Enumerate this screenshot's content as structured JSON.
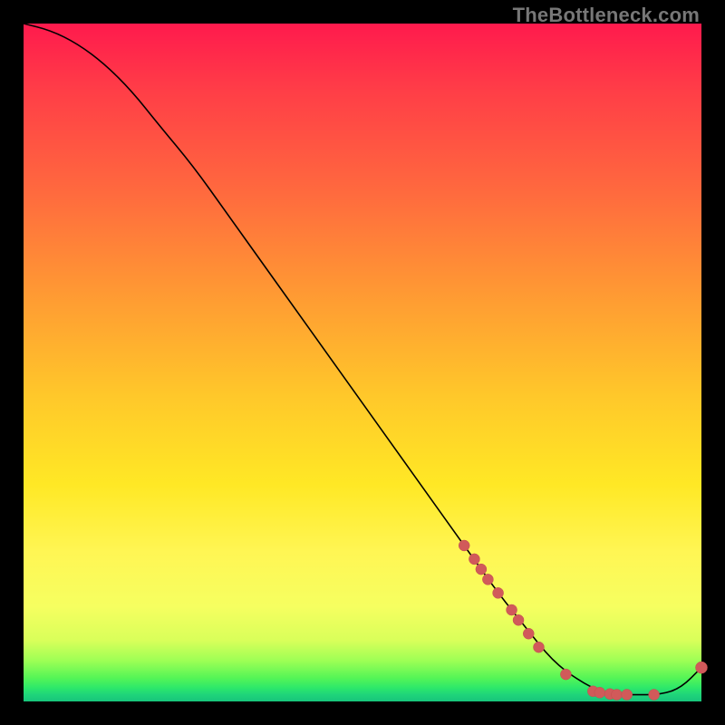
{
  "watermark": "TheBottleneck.com",
  "colors": {
    "background": "#000000",
    "curve": "#000000",
    "marker_fill": "#d15a5a",
    "marker_stroke": "#c24f4f"
  },
  "chart_data": {
    "type": "line",
    "title": "",
    "xlabel": "",
    "ylabel": "",
    "xlim": [
      0,
      100
    ],
    "ylim": [
      0,
      100
    ],
    "grid": false,
    "legend": false,
    "background_gradient": {
      "top": "#ff1a4d",
      "bottom": "#17c57b",
      "description": "vertical red-to-green heat gradient; green only near bottom"
    },
    "series": [
      {
        "name": "bottleneck-curve",
        "x": [
          0,
          4,
          8,
          12,
          16,
          20,
          25,
          30,
          35,
          40,
          45,
          50,
          55,
          60,
          65,
          70,
          74,
          78,
          82,
          86,
          90,
          94,
          97,
          100
        ],
        "y": [
          100,
          99,
          97,
          94,
          90,
          85,
          79,
          72,
          65,
          58,
          51,
          44,
          37,
          30,
          23,
          16,
          11,
          6,
          3,
          1,
          1,
          1,
          2,
          5
        ]
      }
    ],
    "markers": [
      {
        "name": "cluster-a",
        "points": [
          {
            "x": 65,
            "y": 23
          },
          {
            "x": 66.5,
            "y": 21
          },
          {
            "x": 67.5,
            "y": 19.5
          },
          {
            "x": 68.5,
            "y": 18
          },
          {
            "x": 70,
            "y": 16
          }
        ]
      },
      {
        "name": "cluster-b",
        "points": [
          {
            "x": 72,
            "y": 13.5
          },
          {
            "x": 73,
            "y": 12
          },
          {
            "x": 74.5,
            "y": 10
          },
          {
            "x": 76,
            "y": 8
          }
        ]
      },
      {
        "name": "cluster-c",
        "points": [
          {
            "x": 80,
            "y": 4
          }
        ]
      },
      {
        "name": "cluster-d",
        "points": [
          {
            "x": 84,
            "y": 1.5
          },
          {
            "x": 85,
            "y": 1.3
          },
          {
            "x": 86.5,
            "y": 1.1
          },
          {
            "x": 87.5,
            "y": 1
          },
          {
            "x": 89,
            "y": 1
          }
        ]
      },
      {
        "name": "cluster-e",
        "points": [
          {
            "x": 93,
            "y": 1
          }
        ]
      },
      {
        "name": "end-marker",
        "points": [
          {
            "x": 100,
            "y": 5
          }
        ]
      }
    ]
  }
}
